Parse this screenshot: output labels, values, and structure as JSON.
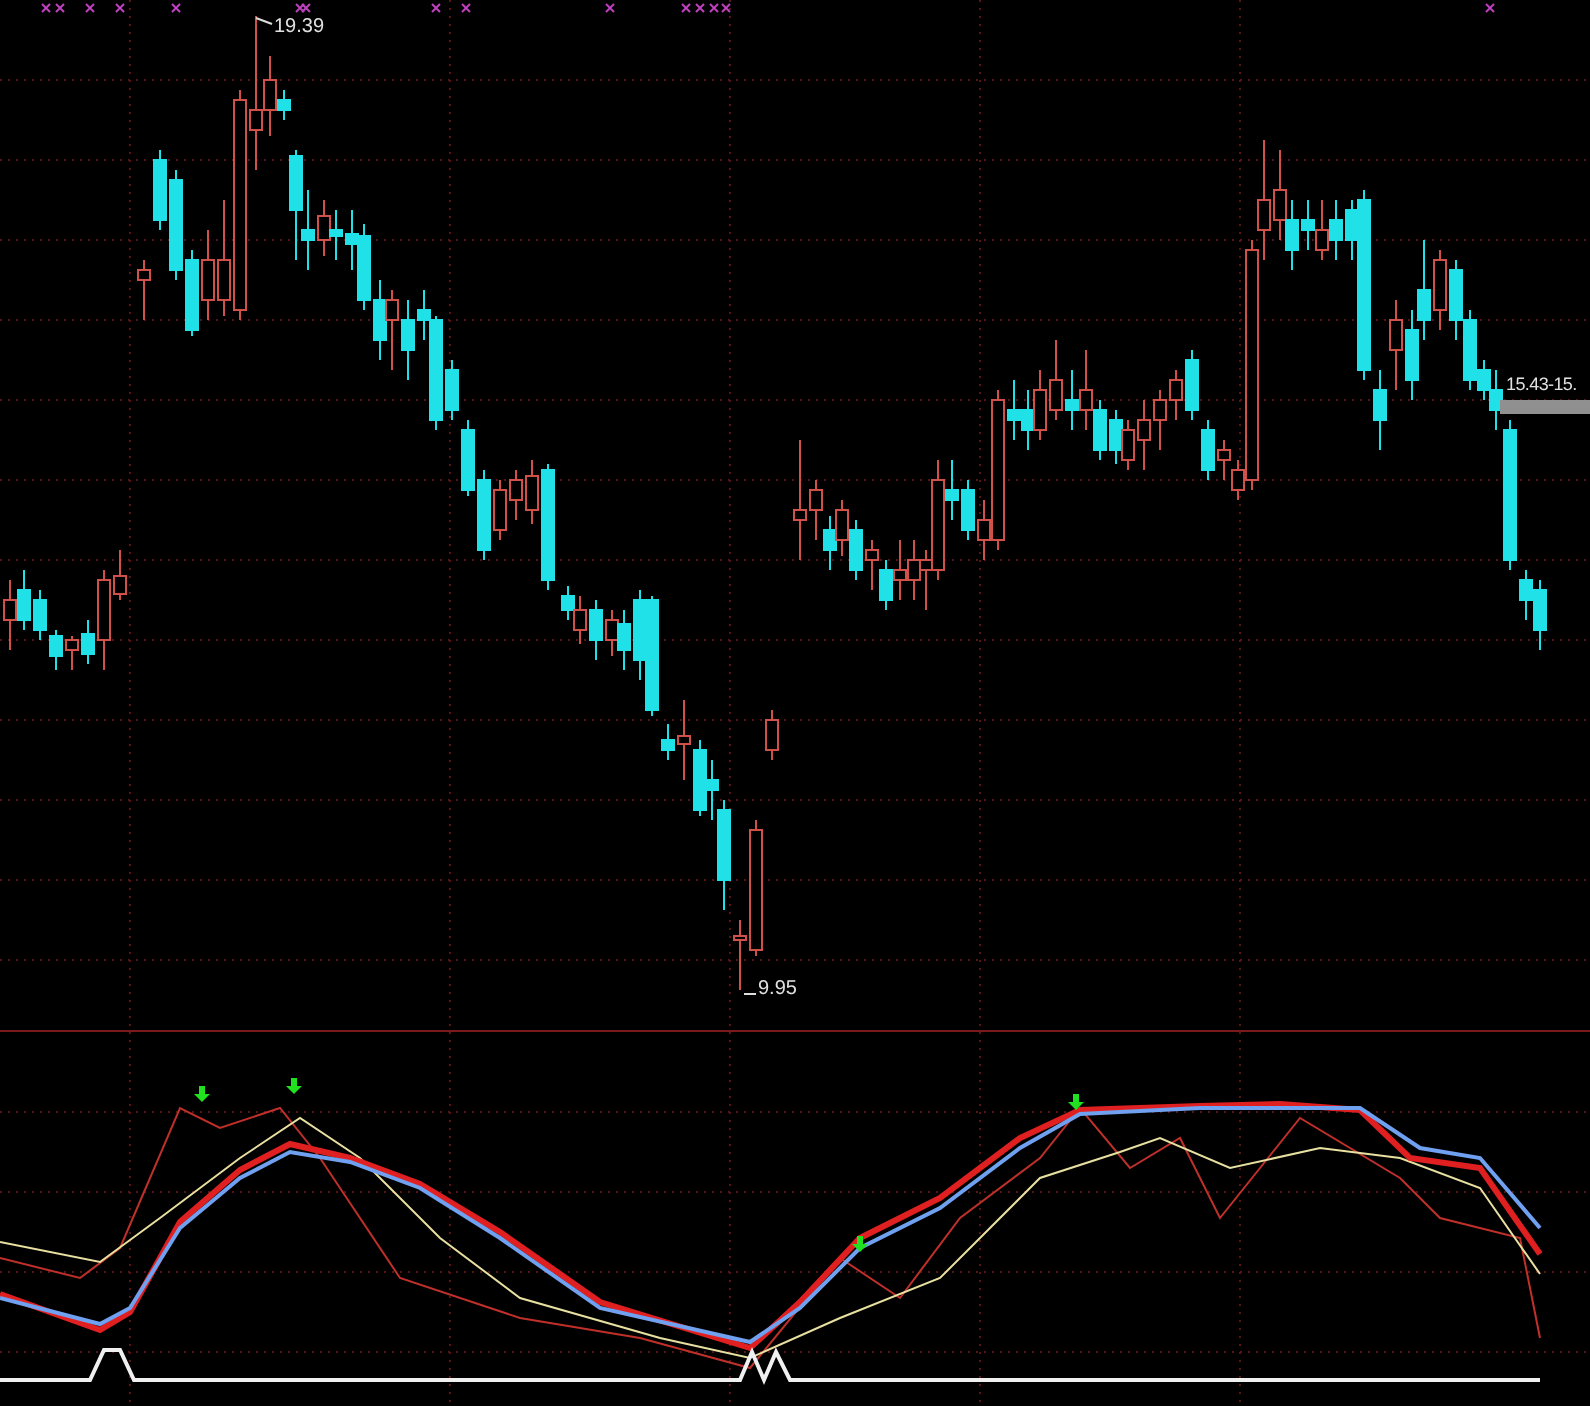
{
  "price_panel": {
    "high_label": "19.39",
    "low_label": "9.95",
    "last_label": "15.43-15."
  }
}
